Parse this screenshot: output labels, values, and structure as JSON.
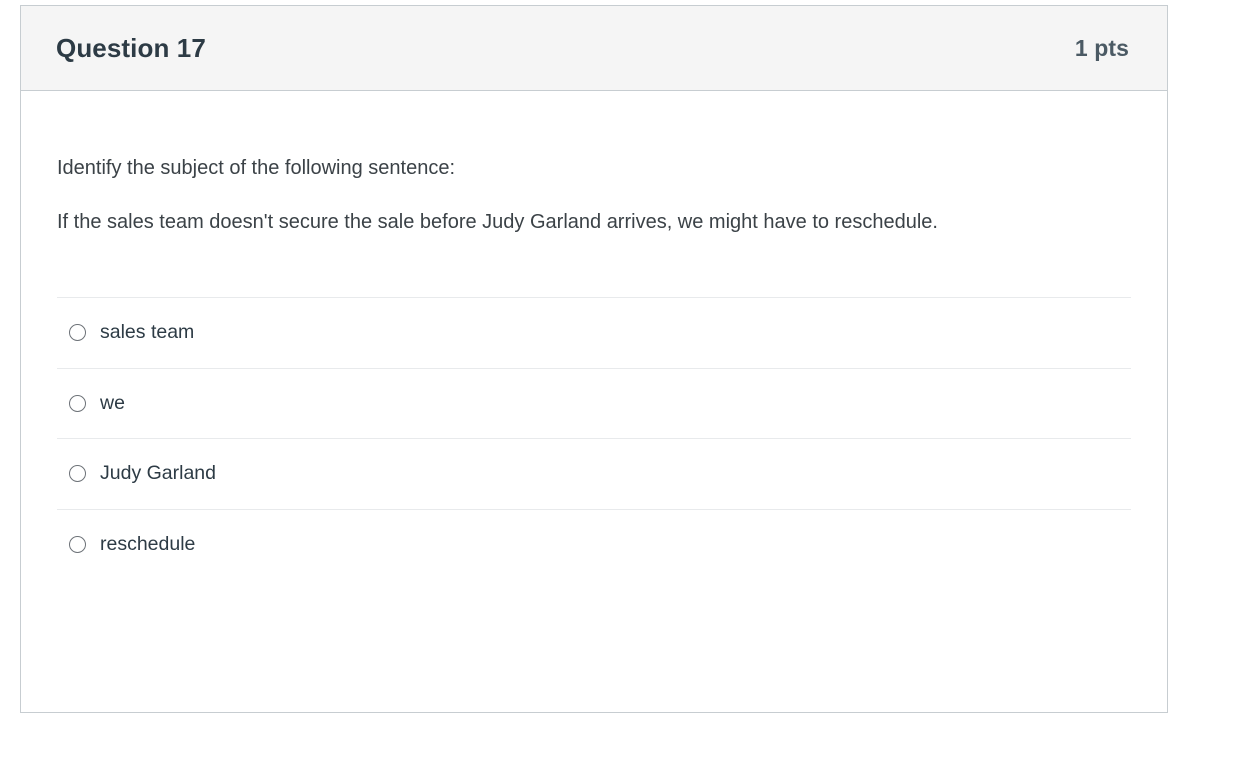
{
  "question": {
    "header": {
      "title": "Question 17",
      "points": "1 pts"
    },
    "prompt_lines": [
      "Identify the subject of the following sentence:",
      "If the sales team doesn't secure the sale before Judy Garland arrives, we might have to reschedule."
    ],
    "answers": [
      {
        "label": "sales team",
        "selected": false,
        "icon": "radio-unchecked-icon"
      },
      {
        "label": "we",
        "selected": false,
        "icon": "radio-unchecked-icon"
      },
      {
        "label": "Judy Garland",
        "selected": false,
        "icon": "radio-unchecked-icon"
      },
      {
        "label": "reschedule",
        "selected": false,
        "icon": "radio-unchecked-icon"
      }
    ]
  },
  "colors": {
    "header_background": "#f5f5f5",
    "card_border": "#c7cdd1",
    "text_primary": "#2d3b45",
    "text_body": "#3b4247",
    "separator": "#e8eaec",
    "radio_border": "#6d7278"
  }
}
